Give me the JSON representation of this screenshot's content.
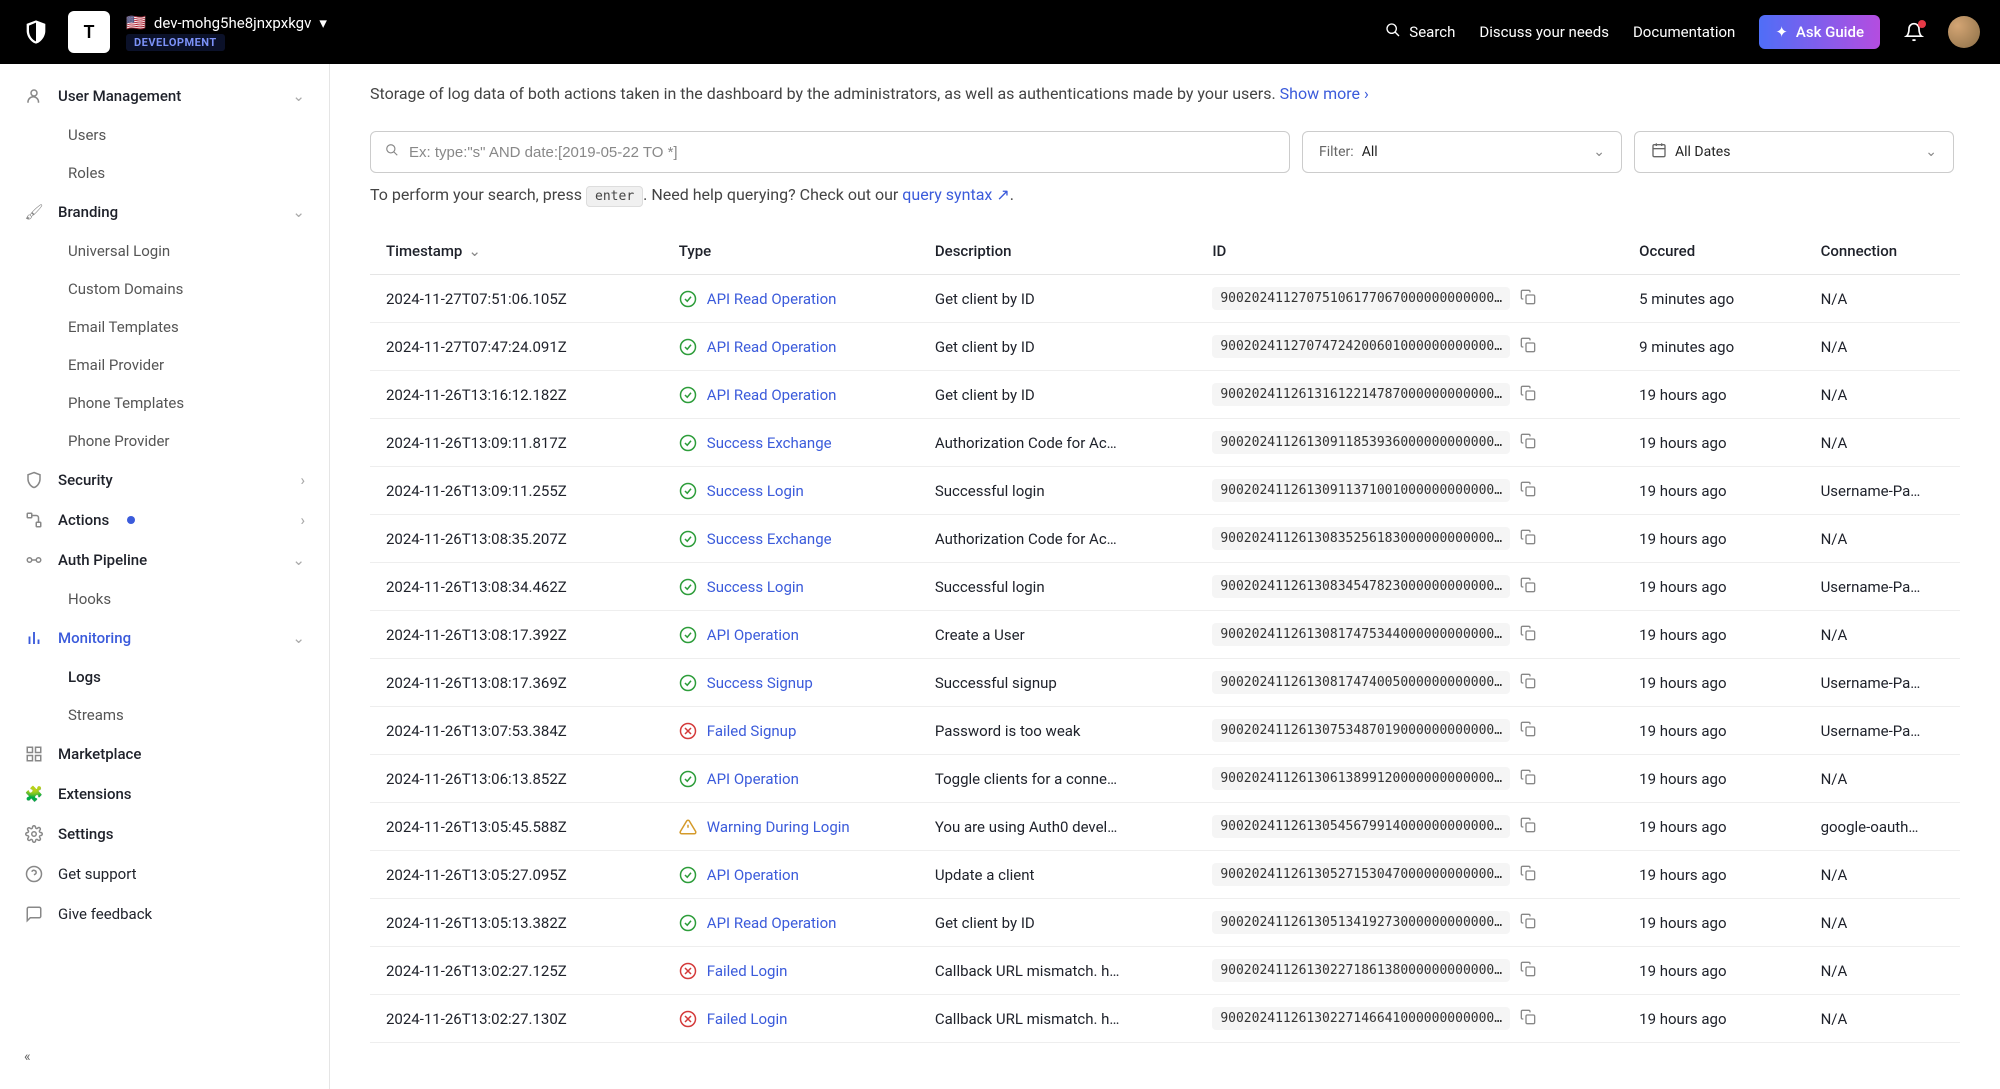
{
  "topbar": {
    "tenant_initial": "T",
    "tenant_name": "dev-mohg5he8jnxpxkgv",
    "env_label": "DEVELOPMENT",
    "search": "Search",
    "discuss": "Discuss your needs",
    "docs": "Documentation",
    "ask_guide": "Ask Guide"
  },
  "sidebar": {
    "user_mgmt": "User Management",
    "users": "Users",
    "roles": "Roles",
    "branding": "Branding",
    "universal_login": "Universal Login",
    "custom_domains": "Custom Domains",
    "email_templates": "Email Templates",
    "email_provider": "Email Provider",
    "phone_templates": "Phone Templates",
    "phone_provider": "Phone Provider",
    "security": "Security",
    "actions": "Actions",
    "auth_pipeline": "Auth Pipeline",
    "hooks": "Hooks",
    "monitoring": "Monitoring",
    "logs": "Logs",
    "streams": "Streams",
    "marketplace": "Marketplace",
    "extensions": "Extensions",
    "settings": "Settings",
    "get_support": "Get support",
    "give_feedback": "Give feedback"
  },
  "main": {
    "intro": "Storage of log data of both actions taken in the dashboard by the administrators, as well as authentications made by your users. ",
    "show_more": "Show more",
    "search_placeholder": "Ex: type:\"s\" AND date:[2019-05-22 TO *]",
    "filter_label": "Filter:",
    "filter_value": "All",
    "date_value": "All Dates",
    "help_prefix": "To perform your search, press ",
    "enter_key": "enter",
    "help_mid": ". Need help querying? Check out our ",
    "query_syntax": "query syntax",
    "help_suffix": "."
  },
  "columns": {
    "timestamp": "Timestamp",
    "type": "Type",
    "description": "Description",
    "id": "ID",
    "occured": "Occured",
    "connection": "Connection"
  },
  "status_kinds": {
    "success": "success",
    "failed": "failed",
    "warning": "warning"
  },
  "rows": [
    {
      "timestamp": "2024-11-27T07:51:06.105Z",
      "status": "success",
      "type": "API Read Operation",
      "description": "Get client by ID",
      "id": "90020241127075106177067000000000000…",
      "occured": "5 minutes ago",
      "connection": "N/A"
    },
    {
      "timestamp": "2024-11-27T07:47:24.091Z",
      "status": "success",
      "type": "API Read Operation",
      "description": "Get client by ID",
      "id": "90020241127074724200601000000000000…",
      "occured": "9 minutes ago",
      "connection": "N/A"
    },
    {
      "timestamp": "2024-11-26T13:16:12.182Z",
      "status": "success",
      "type": "API Read Operation",
      "description": "Get client by ID",
      "id": "90020241126131612214787000000000000…",
      "occured": "19 hours ago",
      "connection": "N/A"
    },
    {
      "timestamp": "2024-11-26T13:09:11.817Z",
      "status": "success",
      "type": "Success Exchange",
      "description": "Authorization Code for Ac…",
      "id": "90020241126130911853936000000000000…",
      "occured": "19 hours ago",
      "connection": "N/A"
    },
    {
      "timestamp": "2024-11-26T13:09:11.255Z",
      "status": "success",
      "type": "Success Login",
      "description": "Successful login",
      "id": "90020241126130911371001000000000000…",
      "occured": "19 hours ago",
      "connection": "Username-Pa…"
    },
    {
      "timestamp": "2024-11-26T13:08:35.207Z",
      "status": "success",
      "type": "Success Exchange",
      "description": "Authorization Code for Ac…",
      "id": "90020241126130835256183000000000000…",
      "occured": "19 hours ago",
      "connection": "N/A"
    },
    {
      "timestamp": "2024-11-26T13:08:34.462Z",
      "status": "success",
      "type": "Success Login",
      "description": "Successful login",
      "id": "90020241126130834547823000000000000…",
      "occured": "19 hours ago",
      "connection": "Username-Pa…"
    },
    {
      "timestamp": "2024-11-26T13:08:17.392Z",
      "status": "success",
      "type": "API Operation",
      "description": "Create a User",
      "id": "90020241126130817475344000000000000…",
      "occured": "19 hours ago",
      "connection": "N/A"
    },
    {
      "timestamp": "2024-11-26T13:08:17.369Z",
      "status": "success",
      "type": "Success Signup",
      "description": "Successful signup",
      "id": "90020241126130817474005000000000000…",
      "occured": "19 hours ago",
      "connection": "Username-Pa…"
    },
    {
      "timestamp": "2024-11-26T13:07:53.384Z",
      "status": "failed",
      "type": "Failed Signup",
      "description": "Password is too weak",
      "id": "90020241126130753487019000000000000…",
      "occured": "19 hours ago",
      "connection": "Username-Pa…"
    },
    {
      "timestamp": "2024-11-26T13:06:13.852Z",
      "status": "success",
      "type": "API Operation",
      "description": "Toggle clients for a conne…",
      "id": "90020241126130613899120000000000000…",
      "occured": "19 hours ago",
      "connection": "N/A"
    },
    {
      "timestamp": "2024-11-26T13:05:45.588Z",
      "status": "warning",
      "type": "Warning During Login",
      "description": "You are using Auth0 devel…",
      "id": "90020241126130545679914000000000000…",
      "occured": "19 hours ago",
      "connection": "google-oauth…"
    },
    {
      "timestamp": "2024-11-26T13:05:27.095Z",
      "status": "success",
      "type": "API Operation",
      "description": "Update a client",
      "id": "90020241126130527153047000000000000…",
      "occured": "19 hours ago",
      "connection": "N/A"
    },
    {
      "timestamp": "2024-11-26T13:05:13.382Z",
      "status": "success",
      "type": "API Read Operation",
      "description": "Get client by ID",
      "id": "90020241126130513419273000000000000…",
      "occured": "19 hours ago",
      "connection": "N/A"
    },
    {
      "timestamp": "2024-11-26T13:02:27.125Z",
      "status": "failed",
      "type": "Failed Login",
      "description": "Callback URL mismatch. h…",
      "id": "90020241126130227186138000000000000…",
      "occured": "19 hours ago",
      "connection": "N/A"
    },
    {
      "timestamp": "2024-11-26T13:02:27.130Z",
      "status": "failed",
      "type": "Failed Login",
      "description": "Callback URL mismatch. h…",
      "id": "90020241126130227146641000000000000…",
      "occured": "19 hours ago",
      "connection": "N/A"
    }
  ]
}
